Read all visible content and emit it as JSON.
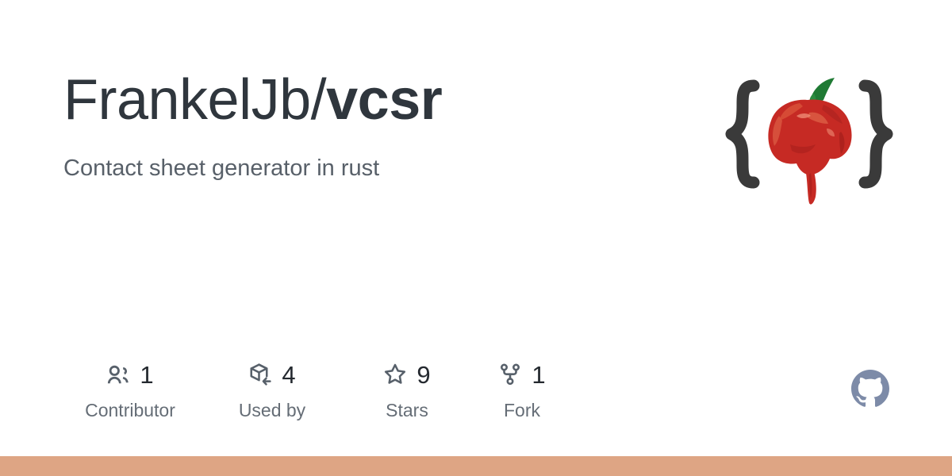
{
  "card": {
    "background_color": "#ffffff"
  },
  "header": {
    "owner": "FrankelJb",
    "separator": "/",
    "repo_name": "vcsr",
    "description": "Contact sheet generator in rust"
  },
  "avatar": {
    "icon_name": "chili-pepper-in-braces-avatar",
    "brace_open": "{",
    "brace_close": "}",
    "brace_color": "#3a3a3a",
    "pepper_color": "#c62a24",
    "stem_color": "#1f7a34"
  },
  "stats": [
    {
      "icon": "people-icon",
      "value": "1",
      "label": "Contributor"
    },
    {
      "icon": "package-used-by-icon",
      "value": "4",
      "label": "Used by"
    },
    {
      "icon": "star-icon",
      "value": "9",
      "label": "Stars"
    },
    {
      "icon": "repo-forked-icon",
      "value": "1",
      "label": "Fork"
    }
  ],
  "branding": {
    "icon_name": "github-mark-icon",
    "color": "#7d8ba8"
  },
  "accent": {
    "name": "language-accent-bar",
    "color": "#dea584"
  }
}
